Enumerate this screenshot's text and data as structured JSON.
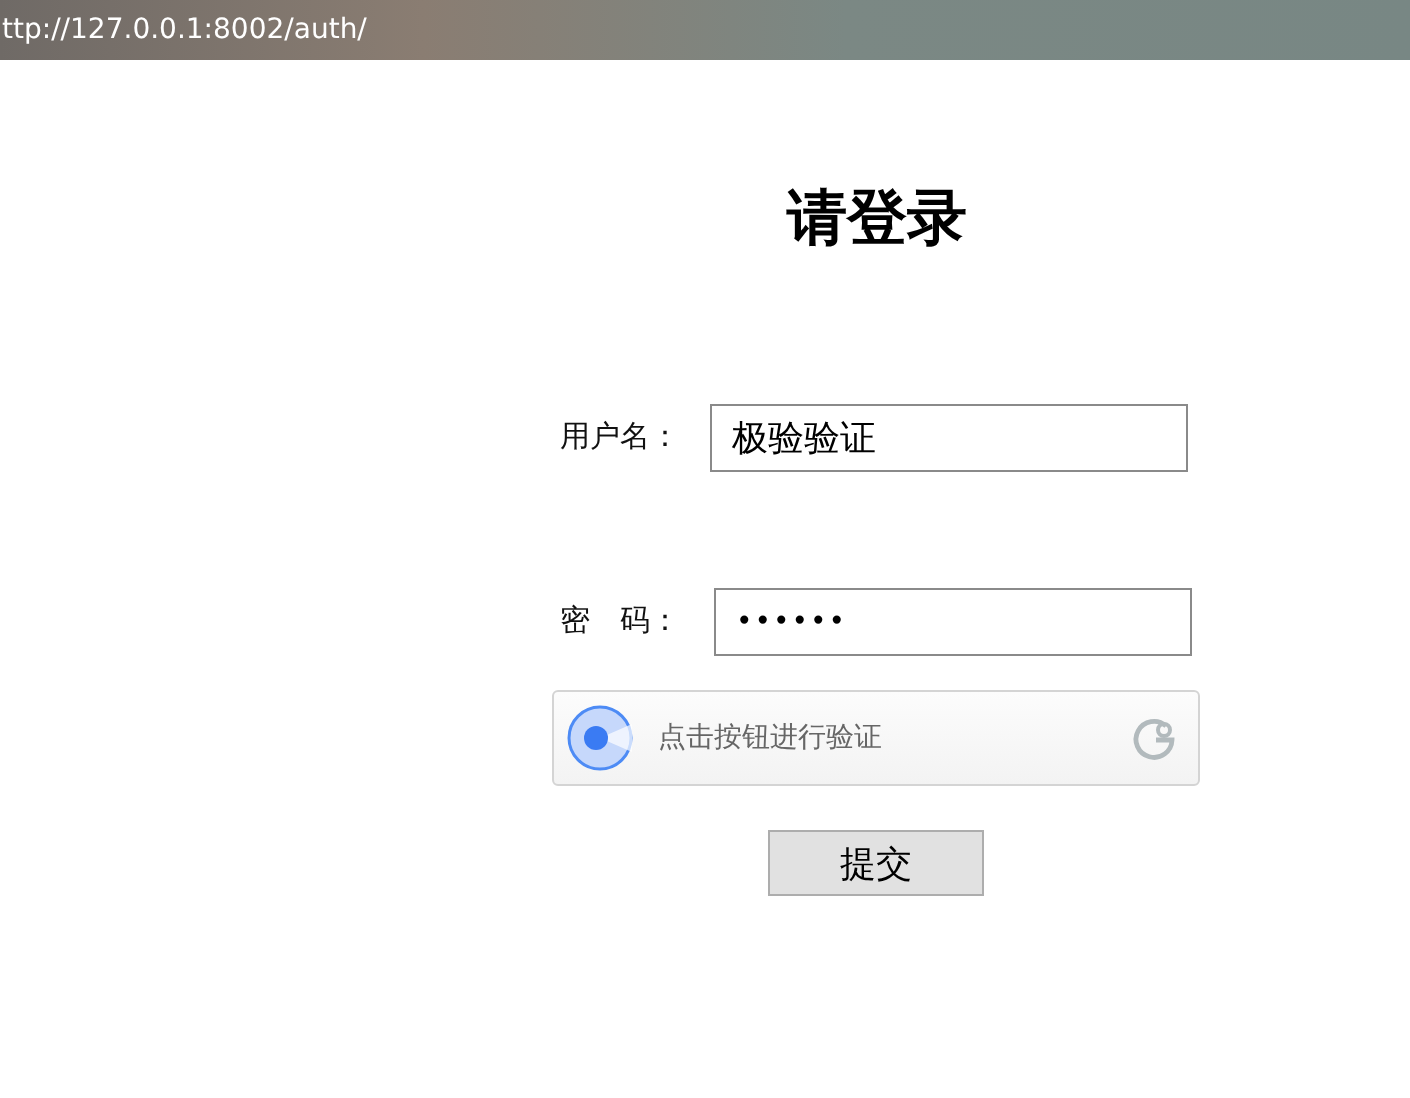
{
  "address_bar": {
    "url": "ttp://127.0.0.1:8002/auth/"
  },
  "title": "请登录",
  "fields": [
    {
      "label": "用户名：",
      "value": "极验验证",
      "kind": "text"
    },
    {
      "label": "密　码：",
      "value": "••••••",
      "kind": "password"
    }
  ],
  "captcha": {
    "label": "点击按钮进行验证"
  },
  "submit": "提交"
}
